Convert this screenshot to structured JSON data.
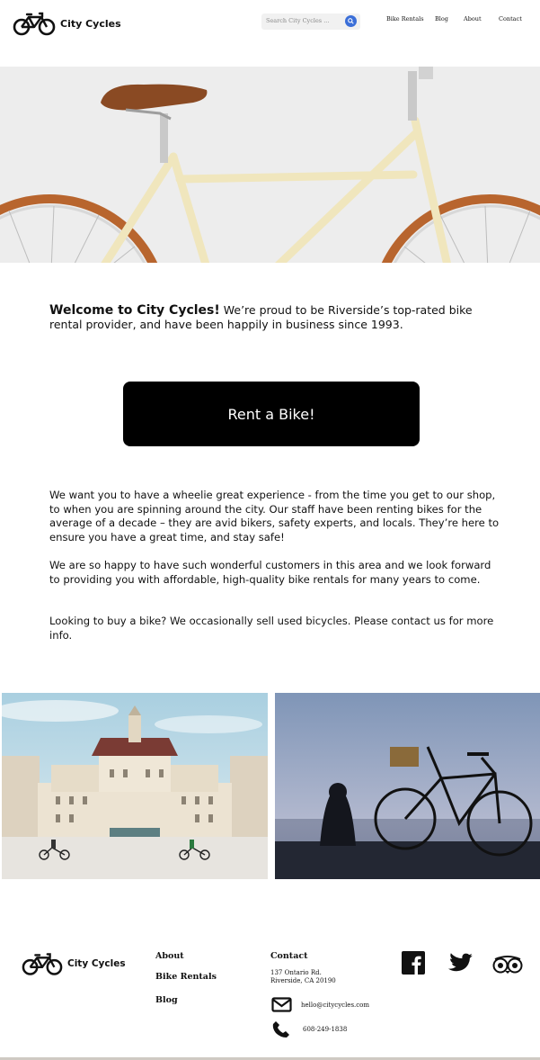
{
  "header": {
    "brand": "City Cycles",
    "search_placeholder": "Search City Cycles ...",
    "nav": [
      "Bike Rentals",
      "Blog",
      "About",
      "Contact"
    ]
  },
  "welcome": {
    "heading": "Welcome to City Cycles!",
    "text": " We’re proud to be Riverside’s top-rated bike rental provider, and have been happily in business since 1993."
  },
  "cta": {
    "label": "Rent a Bike!"
  },
  "body": {
    "p1": "We want you to have a wheelie great experience - from the time you get to our shop, to when you are spinning around the city. Our staff have been renting bikes for the average of a decade – they are avid bikers, safety experts, and locals. They’re here to ensure you have a great time, and stay safe!",
    "p2": "We are so happy to have such wonderful customers in this area and we look forward to providing you with affordable, high-quality bike rentals for many years to come.",
    "p3": "Looking to buy a bike? We occasionally sell used bicycles. Please contact us for more info."
  },
  "footer": {
    "brand": "City Cycles",
    "links": [
      "About",
      "Bike Rentals",
      "Blog"
    ],
    "contact_heading": "Contact",
    "address_line1": "137 Ontario Rd.",
    "address_line2": "Riverside, CA 20190",
    "email": "hello@citycycles.com",
    "phone": "608-249-1838"
  },
  "icons": {
    "logo": "bicycle-icon",
    "search": "search-icon",
    "email": "envelope-icon",
    "phone": "phone-icon",
    "social": [
      "facebook-icon",
      "twitter-icon",
      "tripadvisor-icon"
    ]
  },
  "colors": {
    "accent": "#3b6fd8",
    "button": "#000000",
    "hero_bg": "#ededed"
  }
}
